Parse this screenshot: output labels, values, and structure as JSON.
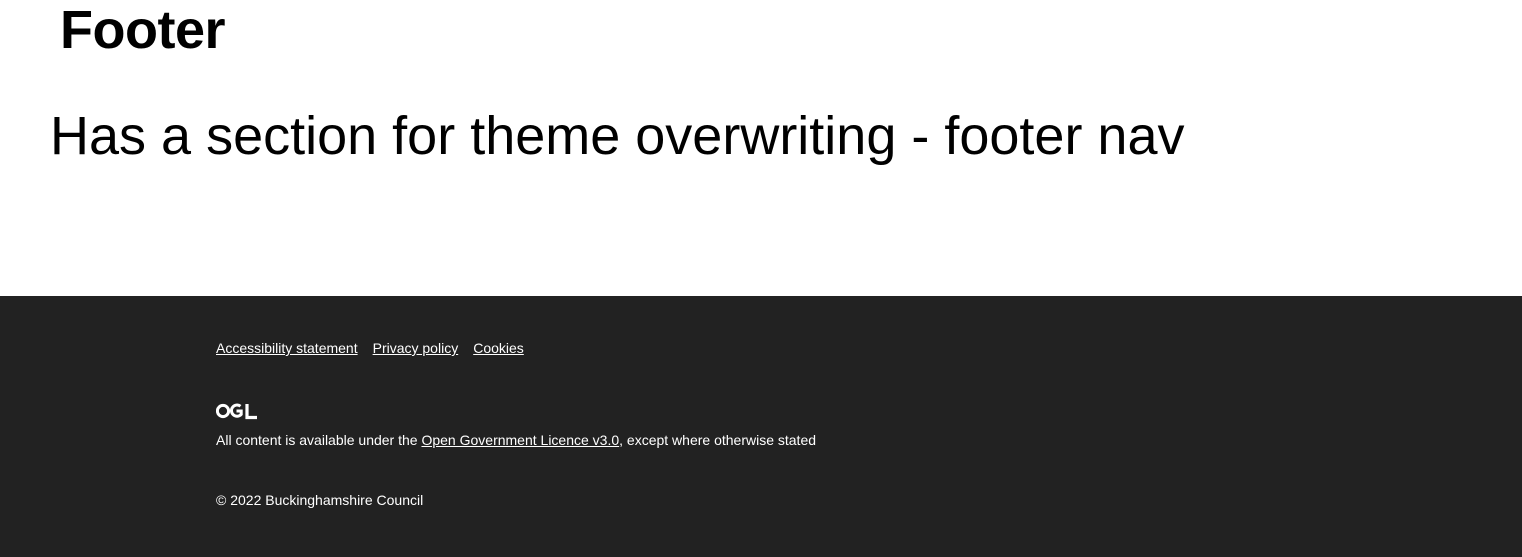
{
  "page": {
    "title": "Footer",
    "description": "Has a section for theme overwriting - footer nav"
  },
  "footer": {
    "nav_links": [
      {
        "label": "Accessibility statement"
      },
      {
        "label": "Privacy policy"
      },
      {
        "label": "Cookies"
      }
    ],
    "logo_icon": "ogl-logo-icon",
    "logo_text": "OGL",
    "licence": {
      "prefix": "All content is available under the ",
      "link_label": "Open Government Licence v3.0",
      "suffix": ", except where otherwise stated"
    },
    "copyright": "© 2022 Buckinghamshire Council"
  },
  "colors": {
    "footer_background": "#222222",
    "footer_text": "#ffffff",
    "page_background": "#ffffff",
    "page_text": "#000000"
  }
}
